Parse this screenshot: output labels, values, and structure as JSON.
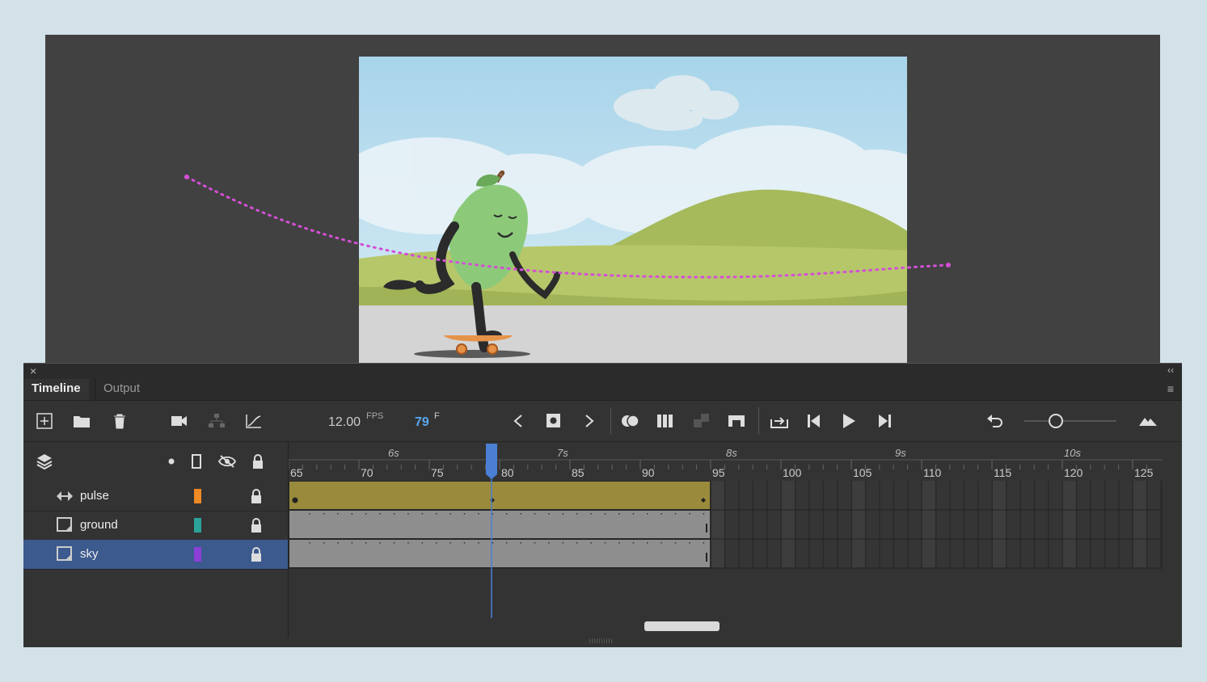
{
  "panel": {
    "close_icon": "×",
    "collapse_icon": "‹‹",
    "menu_icon": "≡"
  },
  "tabs": [
    {
      "label": "Timeline",
      "active": true
    },
    {
      "label": "Output",
      "active": false
    }
  ],
  "toolbar": {
    "fps_value": "12.00",
    "fps_unit": "FPS",
    "current_frame": "79",
    "frame_unit": "F",
    "zoom_level": 0.35,
    "icons": [
      "new-layer-icon",
      "new-folder-icon",
      "delete-icon",
      "camera-icon",
      "layer-depth-icon",
      "ease-graph-icon",
      "previous-keyframe-icon",
      "insert-keyframe-icon",
      "next-keyframe-icon",
      "onion-skin-icon",
      "edit-multiple-frames-icon",
      "create-tween-icon",
      "insert-blank-keyframe-icon",
      "loop-icon",
      "step-back-icon",
      "play-icon",
      "step-forward-icon",
      "undo-icon",
      "fit-icon"
    ]
  },
  "ruler": {
    "seconds": [
      "6s",
      "7s",
      "8s",
      "9s",
      "10s"
    ],
    "frames": [
      "65",
      "70",
      "75",
      "80",
      "85",
      "90",
      "95",
      "100",
      "105",
      "110",
      "115",
      "120",
      "125"
    ],
    "playhead_frame": 79
  },
  "layers": [
    {
      "name": "pulse",
      "color": "#f08a24",
      "type": "motion-tween",
      "selected": false
    },
    {
      "name": "ground",
      "color": "#2ba39a",
      "type": "graphic",
      "selected": false
    },
    {
      "name": "sky",
      "color": "#8c3fd6",
      "type": "graphic",
      "selected": true
    }
  ],
  "tracks": {
    "span_frames": [
      65,
      95
    ],
    "pulse_color": "#9a8b3c",
    "static_color": "#8e8e8e"
  },
  "colors": {
    "accent": "#5aa8ee",
    "playhead": "#4a7fd4",
    "motion_path": "#d44fd6",
    "selected_row": "#3c5a8e"
  }
}
